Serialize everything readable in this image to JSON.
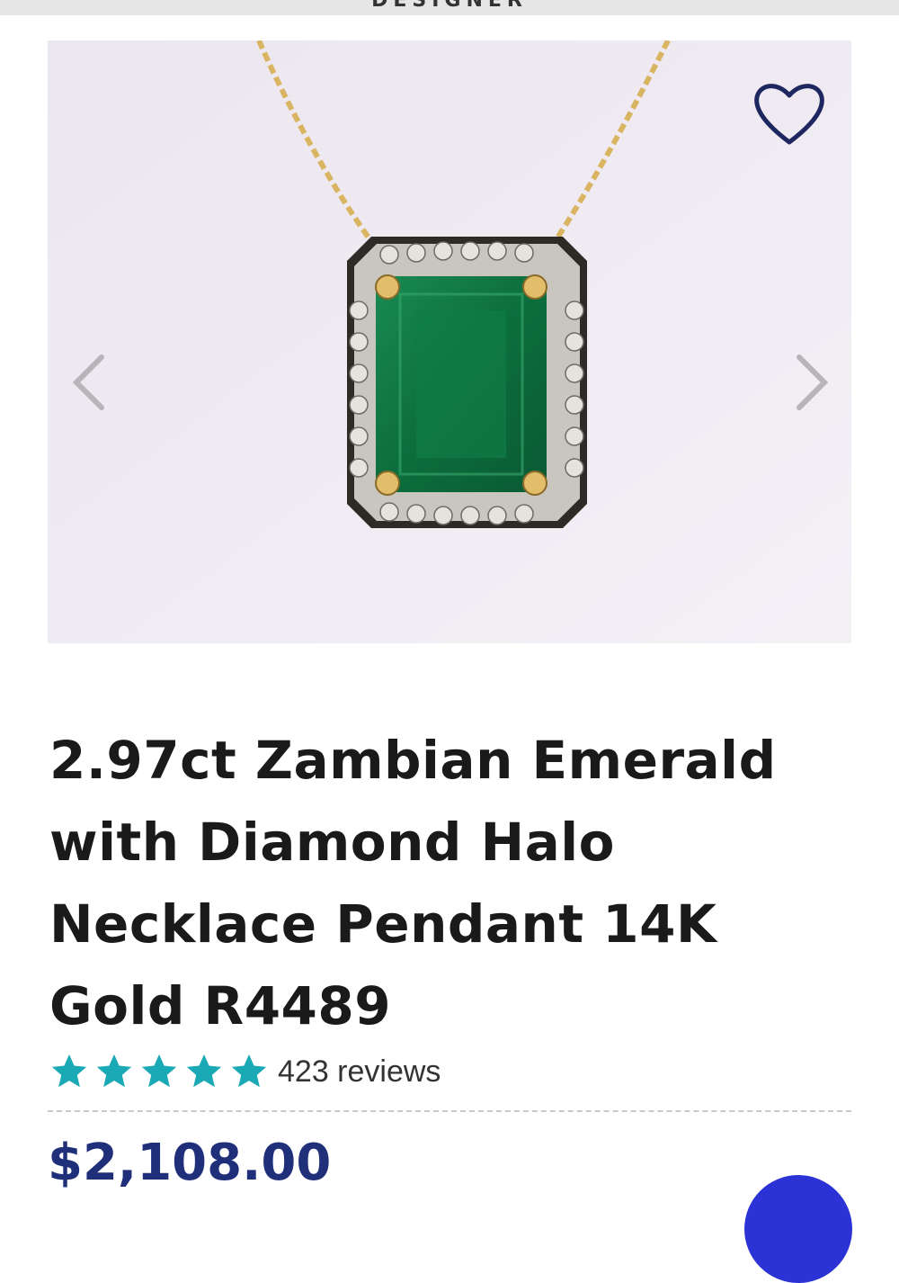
{
  "header": {
    "brand_cut": "DESIGNER"
  },
  "gallery": {
    "prev_icon": "chevron-left-icon",
    "next_icon": "chevron-right-icon",
    "wishlist_icon": "heart-outline-icon"
  },
  "product": {
    "title": "2.97ct Zambian Emerald with Diamond Halo Necklace Pendant 14K Gold R4489",
    "rating_stars": 5,
    "reviews": "423 reviews",
    "price": "$2,108.00"
  },
  "colors": {
    "star": "#1aa9b5",
    "price": "#1f2f7a",
    "fab": "#2b33d6",
    "emerald": "#0d7a43"
  }
}
